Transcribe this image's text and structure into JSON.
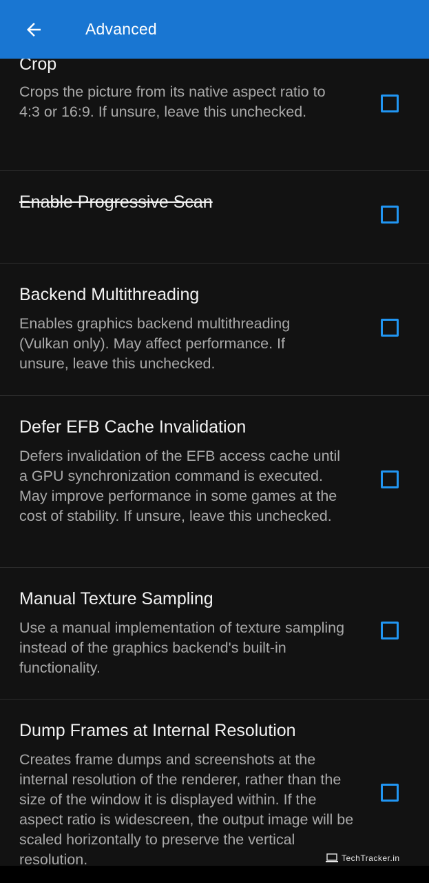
{
  "appbar": {
    "back_icon": "arrow-left-icon",
    "title": "Advanced",
    "color": "#1976d2"
  },
  "settings": [
    {
      "title": "Crop",
      "description": "Crops the picture from its native aspect ratio to 4:3 or 16:9. If unsure, leave this unchecked.",
      "checked": false,
      "strikethrough": false
    },
    {
      "title": "Enable Progressive Scan",
      "description": "",
      "checked": false,
      "strikethrough": true
    },
    {
      "title": "Backend Multithreading",
      "description": "Enables graphics backend multithreading (Vulkan only). May affect performance. If unsure, leave this unchecked.",
      "checked": false,
      "strikethrough": false
    },
    {
      "title": "Defer EFB Cache Invalidation",
      "description": "Defers invalidation of the EFB access cache until a GPU synchronization command is executed. May improve performance in some games at the cost of stability. If unsure, leave this unchecked.",
      "checked": false,
      "strikethrough": false
    },
    {
      "title": "Manual Texture Sampling",
      "description": "Use a manual implementation of texture sampling instead of the graphics backend's built-in functionality.",
      "checked": false,
      "strikethrough": false
    },
    {
      "title": "Dump Frames at Internal Resolution",
      "description": "Creates frame dumps and screenshots at the internal resolution of the renderer, rather than the size of the window it is displayed within. If the aspect ratio is widescreen, the output image will be scaled horizontally to preserve the vertical resolution.",
      "checked": false,
      "strikethrough": false
    }
  ],
  "watermark": {
    "icon": "laptop-icon",
    "text": "TechTracker.in"
  },
  "colors": {
    "background": "#121212",
    "checkbox": "#2196f3",
    "divider": "#2e2e2e"
  }
}
